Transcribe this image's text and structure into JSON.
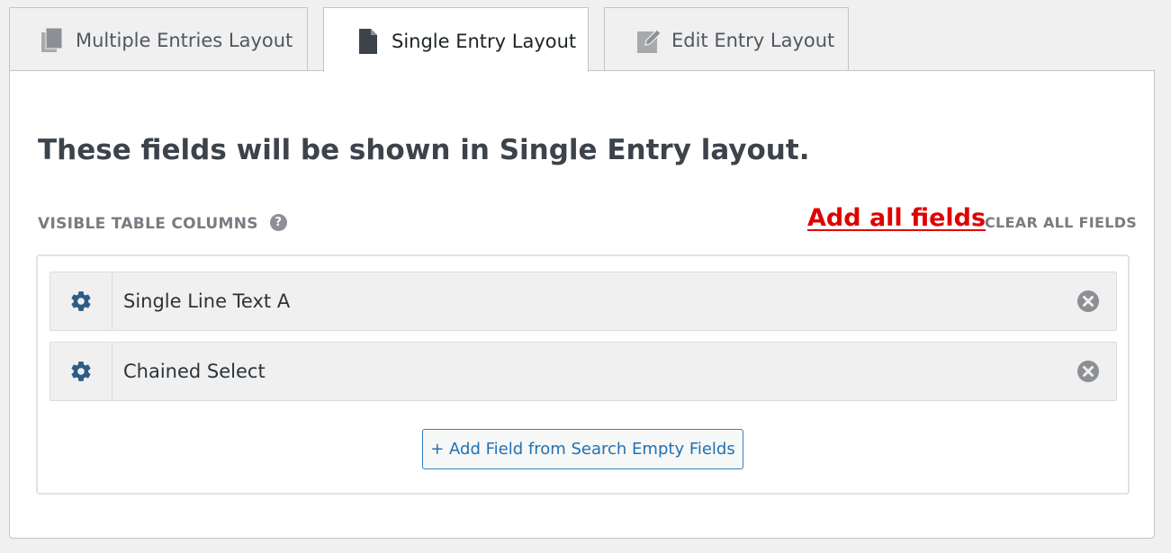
{
  "tabs": [
    {
      "label": "Multiple Entries Layout",
      "icon": "copy-icon",
      "active": false
    },
    {
      "label": "Single Entry Layout",
      "icon": "document-icon",
      "active": true
    },
    {
      "label": "Edit Entry Layout",
      "icon": "edit-icon",
      "active": false
    }
  ],
  "panel": {
    "heading": "These fields will be shown in Single Entry layout.",
    "section_label": "VISIBLE TABLE COLUMNS",
    "help_icon": "?",
    "add_all_label": "Add all fields",
    "clear_all_label": "CLEAR ALL FIELDS",
    "fields": [
      {
        "label": "Single Line Text A"
      },
      {
        "label": "Chained Select"
      }
    ],
    "add_field_button": "+ Add Field from Search Empty Fields"
  },
  "colors": {
    "accent": "#2271b1",
    "gear": "#2c5d87",
    "annotation_red": "#e00000",
    "remove_icon": "#8c8f94"
  }
}
